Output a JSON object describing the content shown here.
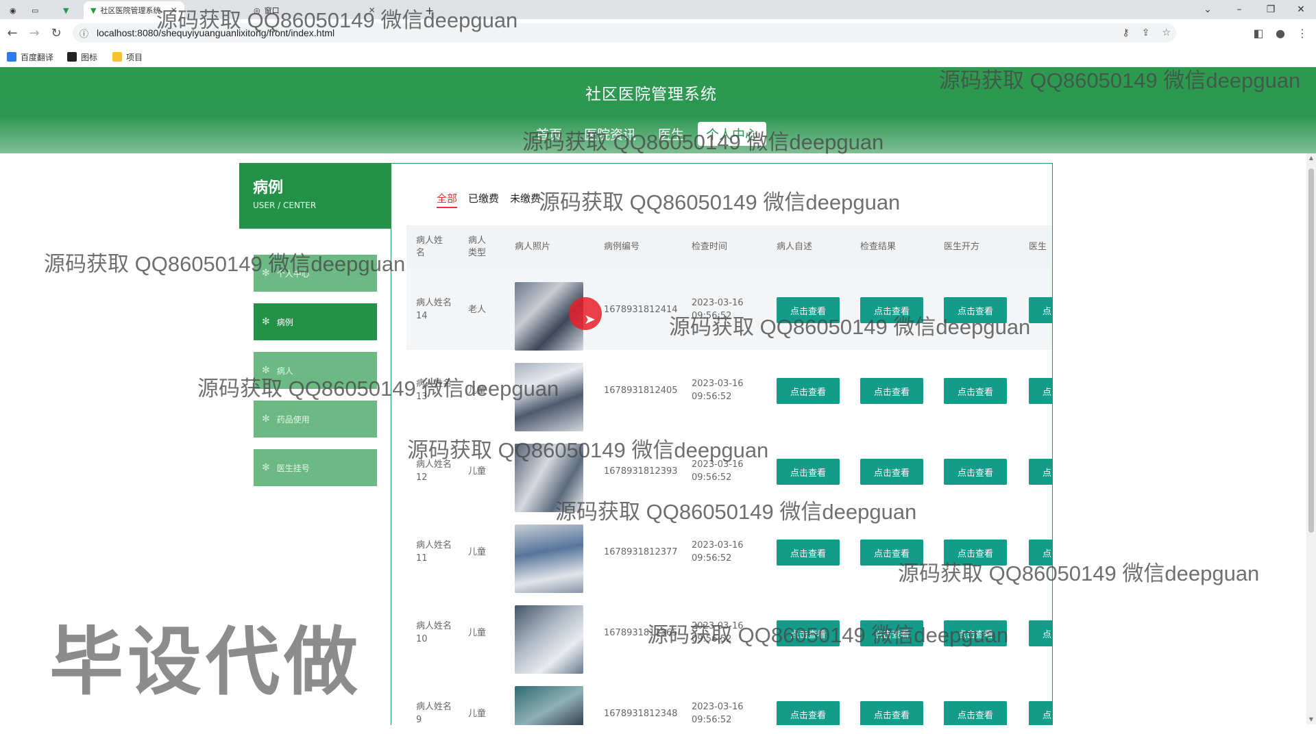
{
  "browser": {
    "tabs": [
      "社区医院管理系统",
      "窗口"
    ],
    "new_tab": "+",
    "url": "localhost:8080/shequyiyuanguanlixitong/front/index.html",
    "bookmarks": [
      "百度翻译",
      "图标",
      "项目"
    ]
  },
  "site": {
    "title": "社区医院管理系统",
    "nav": [
      "首页",
      "医院资讯",
      "医生",
      "个人中心"
    ]
  },
  "sidebar": {
    "heading": "病例",
    "subheading": "USER / CENTER",
    "items": [
      "个人中心",
      "病例",
      "病人",
      "药品使用",
      "医生挂号"
    ]
  },
  "filters": [
    "全部",
    "已缴费",
    "未缴费"
  ],
  "table": {
    "headers": [
      "病人姓名",
      "病人类型",
      "病人照片",
      "病例编号",
      "检查时间",
      "病人自述",
      "检查结果",
      "医生开方",
      "医生"
    ],
    "button_label": "点击查看",
    "button_cut_label": "点",
    "rows": [
      {
        "name": "病人姓名14",
        "type": "老人",
        "case_no": "1678931812414",
        "time": "2023-03-16 09:56:52"
      },
      {
        "name": "病人姓名13",
        "type": "儿童",
        "case_no": "1678931812405",
        "time": "2023-03-16 09:56:52"
      },
      {
        "name": "病人姓名12",
        "type": "儿童",
        "case_no": "1678931812393",
        "time": "2023-03-16 09:56:52"
      },
      {
        "name": "病人姓名11",
        "type": "儿童",
        "case_no": "1678931812377",
        "time": "2023-03-16 09:56:52"
      },
      {
        "name": "病人姓名10",
        "type": "儿童",
        "case_no": "1678931812365",
        "time": "2023-03-16 09:56:52"
      },
      {
        "name": "病人姓名9",
        "type": "儿童",
        "case_no": "1678931812348",
        "time": "2023-03-16 09:56:52"
      }
    ]
  },
  "watermark": {
    "text": "源码获取 QQ86050149 微信deepguan",
    "big": "毕设代做"
  }
}
